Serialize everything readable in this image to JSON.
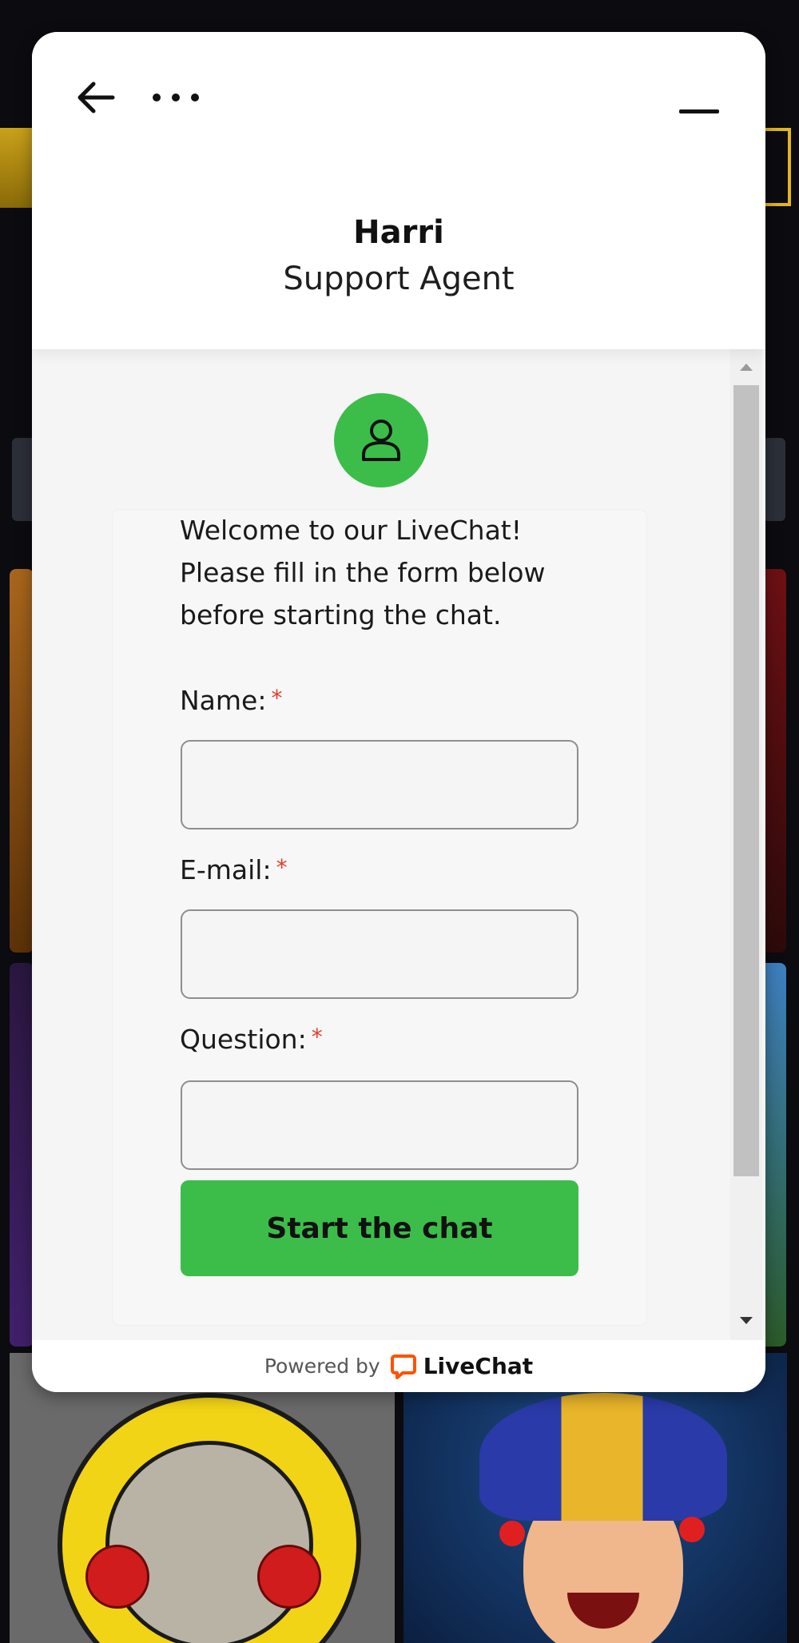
{
  "background": {
    "tiles": [
      "guns-n-roses-game-tile",
      "joker-game-tile"
    ]
  },
  "chat": {
    "header": {
      "back_icon": "arrow-left-icon",
      "more_icon": "ellipsis-icon",
      "minimize_icon": "minimize-icon",
      "agent_name": "Harri",
      "agent_role": "Support Agent"
    },
    "avatar_icon": "user-icon",
    "welcome": "Welcome to our LiveChat!\nPlease fill in the form below\nbefore starting the chat.",
    "fields": [
      {
        "label": "Name:",
        "required_mark": "*",
        "value": ""
      },
      {
        "label": "E-mail:",
        "required_mark": "*",
        "value": ""
      },
      {
        "label": "Question:",
        "required_mark": "*",
        "value": ""
      }
    ],
    "submit_label": "Start the chat",
    "footer": {
      "powered_by": "Powered by",
      "brand": "LiveChat",
      "brand_icon": "livechat-logo-icon"
    }
  },
  "colors": {
    "accent_green": "#3cbd4a",
    "required_red": "#e53b2c",
    "brand_orange": "#ff5100"
  }
}
